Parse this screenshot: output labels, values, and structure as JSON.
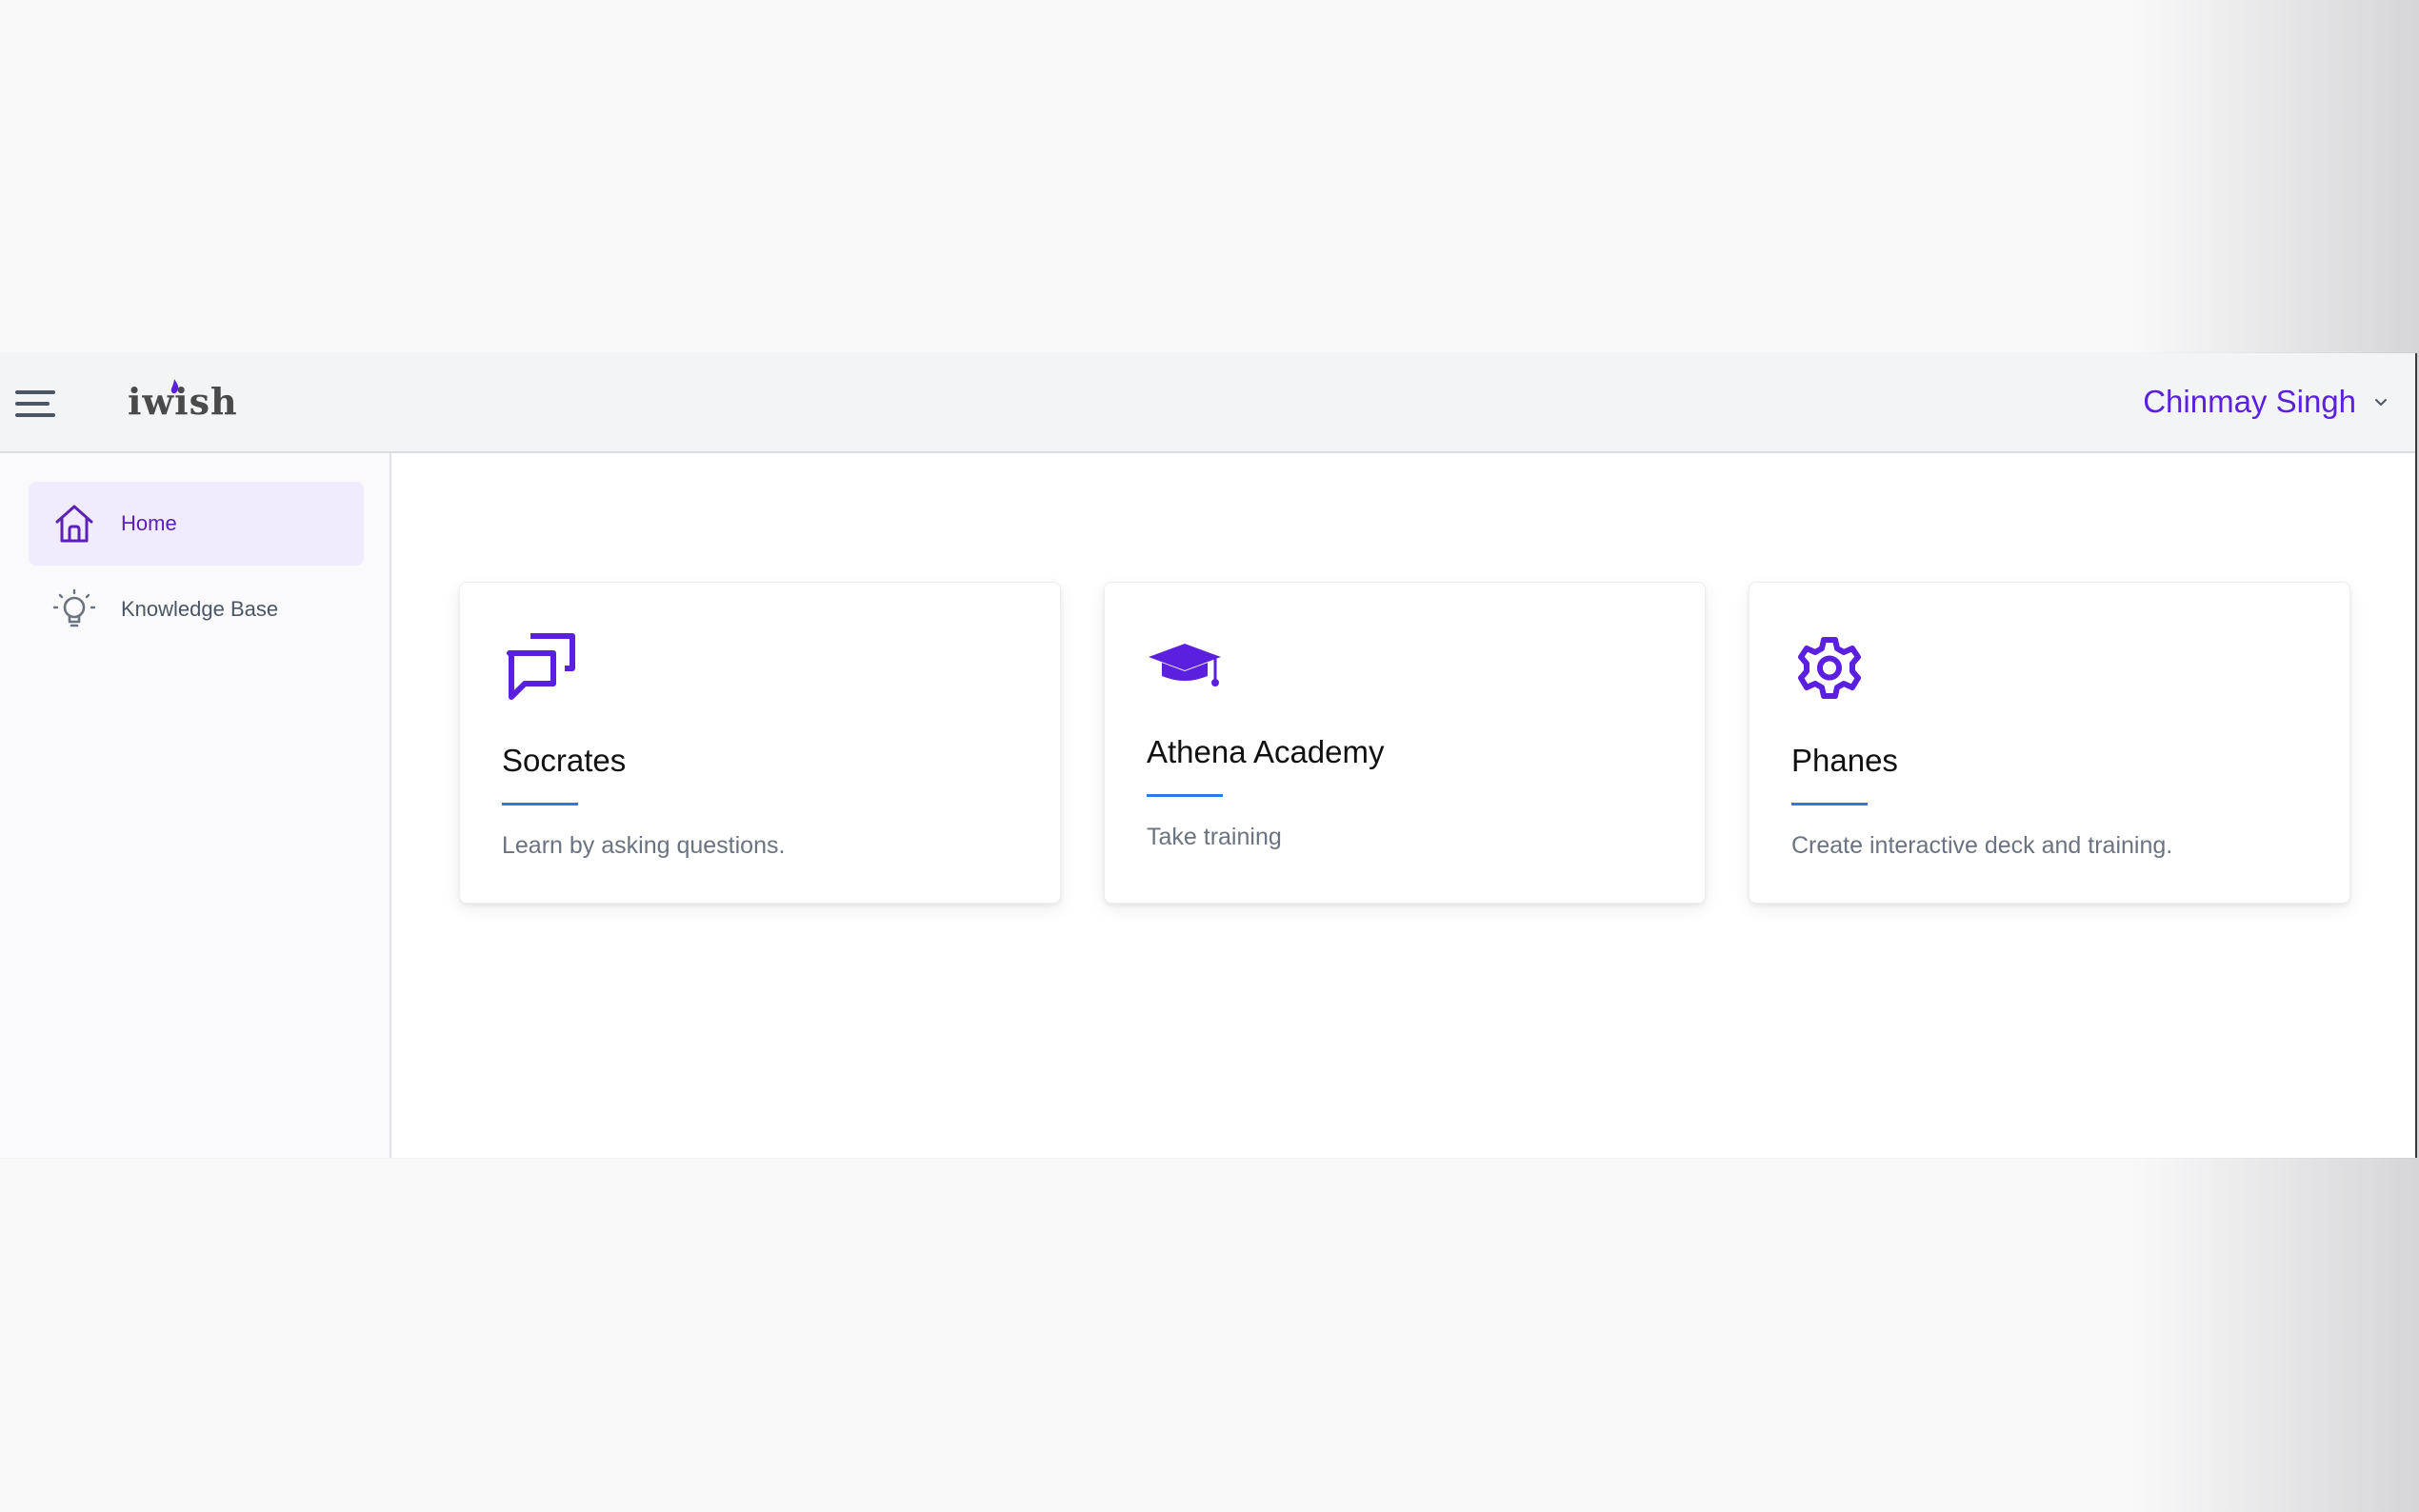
{
  "header": {
    "logo_text": "iwish",
    "user_name": "Chinmay Singh"
  },
  "sidebar": {
    "items": [
      {
        "label": "Home",
        "icon": "home-icon",
        "active": true
      },
      {
        "label": "Knowledge Base",
        "icon": "lightbulb-icon",
        "active": false
      }
    ]
  },
  "cards": [
    {
      "title": "Socrates",
      "description": "Learn by asking questions.",
      "icon": "chat-bubbles-icon"
    },
    {
      "title": "Athena Academy",
      "description": "Take training",
      "icon": "graduation-cap-icon"
    },
    {
      "title": "Phanes",
      "description": "Create interactive deck and training.",
      "icon": "gear-icon"
    }
  ],
  "colors": {
    "accent": "#5b1fe0",
    "underline": "#2d7be0",
    "active_nav_bg": "#f0ebfd"
  }
}
